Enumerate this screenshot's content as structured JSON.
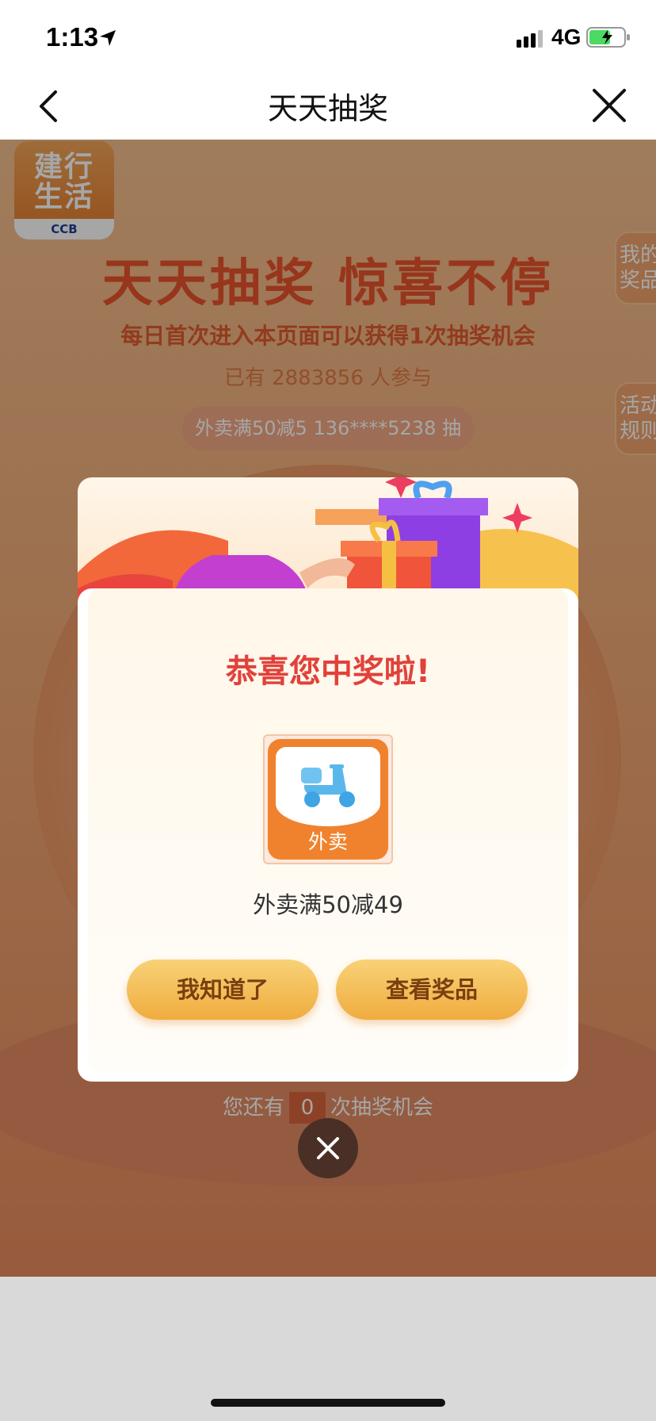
{
  "status_bar": {
    "time": "1:13",
    "network": "4G"
  },
  "nav": {
    "title": "天天抽奖"
  },
  "page": {
    "logo": {
      "line1": "建行",
      "line2": "生活",
      "sub": "CCB"
    },
    "title": "天天抽奖 惊喜不停",
    "subtitle": "每日首次进入本页面可以获得1次抽奖机会",
    "participants": "已有 2883856 人参与",
    "ticker": "外卖满50减5 136****5238 抽",
    "side_tabs": [
      "我的奖品",
      "活动规则"
    ],
    "remaining_prefix": "您还有",
    "remaining_count": "0",
    "remaining_suffix": "次抽奖机会"
  },
  "modal": {
    "title": "恭喜您中奖啦!",
    "prize_label": "外卖",
    "prize_name": "外卖满50减49",
    "buttons": {
      "know": "我知道了",
      "view": "查看奖品"
    }
  },
  "colors": {
    "accent": "#e2413b",
    "button": "#f0ac3f",
    "background": "#f0a571"
  }
}
